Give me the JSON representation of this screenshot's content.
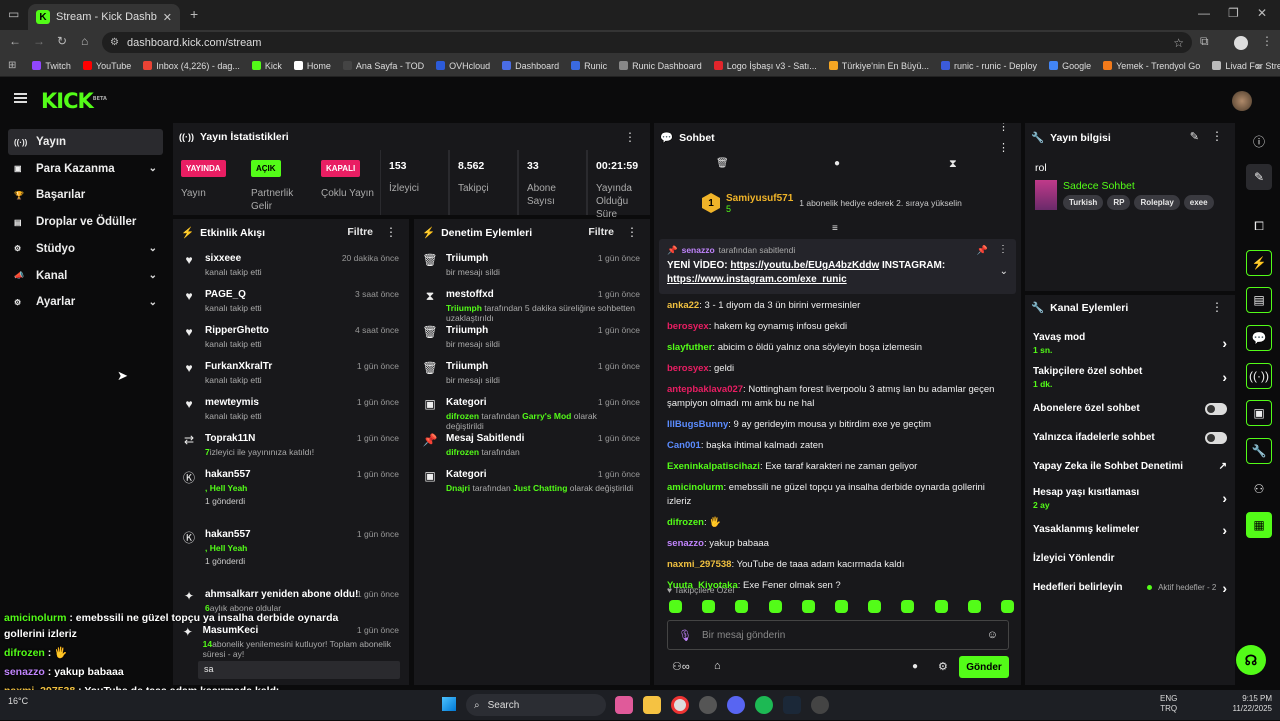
{
  "browser": {
    "tab_title": "Stream - Kick Dashboard",
    "url": "dashboard.kick.com/stream",
    "bookmarks": [
      {
        "label": "Twitch",
        "color": "#9146ff"
      },
      {
        "label": "YouTube",
        "color": "#ff0000"
      },
      {
        "label": "Inbox (4,226) - dag...",
        "color": "#ea4335"
      },
      {
        "label": "Kick",
        "color": "#53fc18"
      },
      {
        "label": "Home",
        "color": "#ffffff"
      },
      {
        "label": "Ana Sayfa - TOD",
        "color": "#444444"
      },
      {
        "label": "OVHcloud",
        "color": "#2c5bd9"
      },
      {
        "label": "Dashboard",
        "color": "#4a6de5"
      },
      {
        "label": "Runic",
        "color": "#3a6ae0"
      },
      {
        "label": "Runic Dashboard",
        "color": "#888888"
      },
      {
        "label": "Logo İşbaşı v3 - Satı...",
        "color": "#e2252b"
      },
      {
        "label": "Türkiye'nin En Büyü...",
        "color": "#f5a623"
      },
      {
        "label": "runic - runic - Deploy",
        "color": "#3b5bdb"
      },
      {
        "label": "Google",
        "color": "#4285f4"
      },
      {
        "label": "Yemek - Trendyol Go",
        "color": "#f27a1a"
      },
      {
        "label": "Livad For Streamers",
        "color": "#bbbbbb"
      }
    ]
  },
  "kick": {
    "logo": "KICK",
    "beta": "BETA"
  },
  "sidebar": [
    {
      "label": "Yayın",
      "icon": "broadcast-icon",
      "active": true,
      "chev": false
    },
    {
      "label": "Para Kazanma",
      "icon": "wallet-icon",
      "chev": true
    },
    {
      "label": "Başarılar",
      "icon": "trophy-icon",
      "chev": false
    },
    {
      "label": "Droplar ve Ödüller",
      "icon": "gift-icon",
      "chev": false
    },
    {
      "label": "Stüdyo",
      "icon": "studio-icon",
      "chev": true
    },
    {
      "label": "Kanal",
      "icon": "megaphone-icon",
      "chev": true
    },
    {
      "label": "Ayarlar",
      "icon": "gear-icon",
      "chev": true
    }
  ],
  "stats": {
    "title": "Yayın İstatistikleri",
    "badges": [
      {
        "text": "YAYINDA",
        "label": "Yayın",
        "bg": "#e91e63",
        "fg": "#fff"
      },
      {
        "text": "AÇIK",
        "label": "Partnerlik Gelir",
        "bg": "#53fc18",
        "fg": "#000"
      },
      {
        "text": "KAPALI",
        "label": "Çoklu Yayın",
        "bg": "#e91e63",
        "fg": "#fff"
      }
    ],
    "values": [
      {
        "value": "153",
        "label": "İzleyici"
      },
      {
        "value": "8.562",
        "label": "Takipçi"
      },
      {
        "value": "33",
        "label": "Abone Sayısı"
      },
      {
        "value": "00:21:59",
        "label": "Yayında Olduğu Süre"
      }
    ]
  },
  "activity": {
    "title": "Etkinlik Akışı",
    "filter": "Filtre",
    "items": [
      {
        "name": "sixxeee",
        "sub": "kanalı takip etti",
        "time": "20 dakika önce",
        "icon": "♥"
      },
      {
        "name": "PAGE_Q",
        "sub": "kanalı takip etti",
        "time": "3 saat önce",
        "icon": "♥"
      },
      {
        "name": "RipperGhetto",
        "sub": "kanalı takip etti",
        "time": "4 saat önce",
        "icon": "♥"
      },
      {
        "name": "FurkanXkralTr",
        "sub": "kanalı takip etti",
        "time": "1 gün önce",
        "icon": "♥"
      },
      {
        "name": "mewteymis",
        "sub": "kanalı takip etti",
        "time": "1 gün önce",
        "icon": "♥"
      },
      {
        "name": "Toprak11N",
        "sub": "izleyici ile yayınınıza katıldı!",
        "num": "7",
        "time": "1 gün önce",
        "icon": "⇄"
      },
      {
        "name": "hakan557",
        "sub": ", Hell Yeah",
        "extra": "1 gönderdi",
        "time": "1 gün önce",
        "icon": "Ⓚ"
      },
      {
        "name": "hakan557",
        "sub": ", Hell Yeah",
        "extra": "1 gönderdi",
        "time": "1 gün önce",
        "icon": "Ⓚ"
      },
      {
        "name": "ahmsalkarr yeniden abone oldu!",
        "sub": "aylık abone oldular",
        "num": "6",
        "time": "1 gün önce",
        "icon": "✦"
      },
      {
        "name": "MasumKeci",
        "sub": "abonelik yenilemesini kutluyor! Toplam abonelik süresi -",
        "num": "14",
        "tail": " ay!",
        "time": "1 gün önce",
        "icon": "✦"
      }
    ],
    "reply": "sa"
  },
  "moderation": {
    "title": "Denetim Eylemleri",
    "filter": "Filtre",
    "items": [
      {
        "name": "Triiumph",
        "sub": "bir mesajı sildi",
        "time": "1 gün önce",
        "icon": "🗑"
      },
      {
        "name": "mestoffxd",
        "subg": "Triiumph",
        "sub": " tarafından 5 dakika süreliğine sohbetten uzaklaştırıldı",
        "time": "1 gün önce",
        "icon": "⧗"
      },
      {
        "name": "Triiumph",
        "sub": "bir mesajı sildi",
        "time": "1 gün önce",
        "icon": "🗑"
      },
      {
        "name": "Triiumph",
        "sub": "bir mesajı sildi",
        "time": "1 gün önce",
        "icon": "🗑"
      },
      {
        "name": "Kategori",
        "subg": "difrozen",
        "sub": " tarafından ",
        "subg2": "Garry's Mod",
        "sub2": " olarak değiştirildi",
        "time": "1 gün önce",
        "icon": "▣"
      },
      {
        "name": "Mesaj Sabitlendi",
        "subg": "difrozen",
        "sub": " tarafından",
        "time": "1 gün önce",
        "icon": "📌"
      },
      {
        "name": "Kategori",
        "subg": "Dnajri",
        "sub": " tarafından ",
        "subg2": "Just Chatting",
        "sub2": " olarak değiştirildi",
        "time": "1 gün önce",
        "icon": "▣"
      }
    ]
  },
  "chat": {
    "title": "Sohbet",
    "gift_user": "Samiyusuf571",
    "gift_count": "5",
    "gift_text": "1 abonelik hediye ederek 2. sıraya yükselin",
    "pinned_by": "senazzo",
    "pinned_suffix": "tarafından sabitlendi",
    "pinned_text1": "YENİ VİDEO: ",
    "pinned_link1": "https://youtu.be/EUgA4bzKddw",
    "pinned_text2": " INSTAGRAM:",
    "pinned_link2": "https://www.instagram.com/exe_runic",
    "messages": [
      {
        "user": "anka22",
        "color": "#f0c040",
        "text": "3 - 1 diyom da 3 ün birini vermesinler"
      },
      {
        "user": "berosyex",
        "color": "#e91e63",
        "text": "hakem kg oynamış infosu gekdi"
      },
      {
        "user": "slayfuther",
        "color": "#53fc18",
        "text": "abicim o öldü yalnız ona söyleyin boşa izlemesin"
      },
      {
        "user": "berosyex",
        "color": "#e91e63",
        "text": "geldi"
      },
      {
        "user": "antepbaklava027",
        "color": "#e91e63",
        "text": "Nottingham forest liverpoolu 3 atmış lan bu adamlar geçen şampiyon olmadı mı amk bu ne hal"
      },
      {
        "user": "IllBugsBunny",
        "color": "#5b8cff",
        "text": "9 ay gerideyim mousa yı bitirdim exe ye geçtim"
      },
      {
        "user": "Can001",
        "color": "#5b8cff",
        "text": "başka ihtimal kalmadı zaten"
      },
      {
        "user": "Exeninkalpatiscihazi",
        "color": "#53fc18",
        "text": "Exe taraf karakteri ne zaman geliyor"
      },
      {
        "user": "amicinolurm",
        "color": "#53fc18",
        "text": "emebssili ne güzel topçu ya insalha derbide oynarda gollerini izleriz"
      },
      {
        "user": "difrozen",
        "color": "#53fc18",
        "text": "🖐"
      },
      {
        "user": "senazzo",
        "color": "#c084fc",
        "text": "yakup babaaa"
      },
      {
        "user": "naxmi_297538",
        "color": "#f0c040",
        "text": "YouTube de taaa adam kacırmada kaldı"
      },
      {
        "user": "Yuuta_Kiyotaka",
        "color": "#53fc18",
        "text": "Exe Fener olmak sen ?"
      }
    ],
    "followers_only": "Takipçilere Özel",
    "placeholder": "Bir mesaj gönderin",
    "send": "Gönder"
  },
  "info": {
    "title": "Yayın bilgisi",
    "field": "rol",
    "category": "Sadece Sohbet",
    "tags": [
      "Turkish",
      "RP",
      "Roleplay",
      "exee"
    ]
  },
  "channel": {
    "title": "Kanal Eylemleri",
    "items": [
      {
        "label": "Yavaş mod",
        "sub": "1 sn.",
        "type": "chev"
      },
      {
        "label": "Takipçilere özel sohbet",
        "sub": "1 dk.",
        "type": "chev"
      },
      {
        "label": "Abonelere özel sohbet",
        "type": "toggle"
      },
      {
        "label": "Yalnızca ifadelerle sohbet",
        "type": "toggle"
      },
      {
        "label": "Yapay Zeka ile Sohbet Denetimi",
        "type": "ext"
      },
      {
        "label": "Hesap yaşı kısıtlaması",
        "sub": "2 ay",
        "type": "chev"
      },
      {
        "label": "Yasaklanmış kelimeler",
        "type": "chev"
      },
      {
        "label": "İzleyici Yönlendir",
        "type": "none"
      },
      {
        "label": "Hedefleri belirleyin",
        "note": "Aktif hedefler - 2",
        "type": "chev"
      }
    ]
  },
  "overlay": [
    {
      "user": "amicinolurm",
      "color": "#53fc18",
      "text": "emebssili ne güzel topçu ya insalha derbide oynarda gollerini izleriz"
    },
    {
      "user": "difrozen",
      "color": "#53fc18",
      "text": "🖐"
    },
    {
      "user": "senazzo",
      "color": "#c084fc",
      "text": "yakup babaaa"
    },
    {
      "user": "naxmi_297538",
      "color": "#f0c040",
      "text": "YouTube de taaa adam kacırmada kaldı"
    },
    {
      "user": "Yuuta_Kiyotaka",
      "color": "#53fc18",
      "text": "Exe Fener olmak sen ?"
    }
  ],
  "taskbar": {
    "search": "Search",
    "weather": "16°C",
    "lang1": "ENG",
    "lang2": "TRQ",
    "time": "9:15 PM",
    "date": "11/22/2025"
  }
}
